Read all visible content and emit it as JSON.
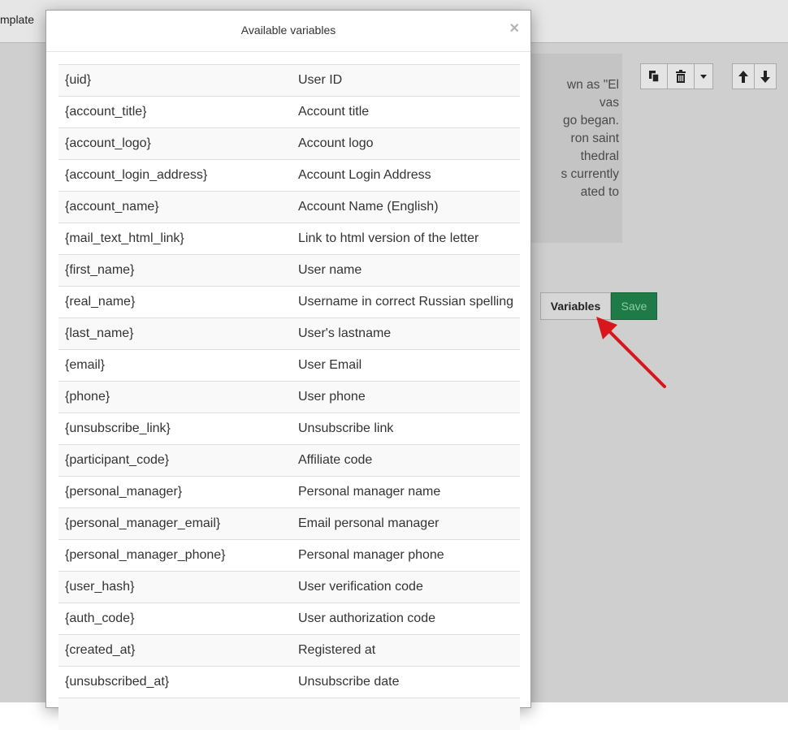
{
  "background": {
    "template_tab": "mplate",
    "preview_text": "wn as \"El\nvas\ngo began.\nron saint\nthedral\ns currently\nated to",
    "variables_button": "Variables",
    "save_button": "Save",
    "colors": {
      "save": "#1e7a46",
      "annotation_arrow": "#d8161c"
    }
  },
  "modal": {
    "title": "Available variables",
    "close": "×",
    "rows": [
      {
        "var": "{uid}",
        "desc": "User ID"
      },
      {
        "var": "{account_title}",
        "desc": "Account title"
      },
      {
        "var": "{account_logo}",
        "desc": "Account logo"
      },
      {
        "var": "{account_login_address}",
        "desc": "Account Login Address"
      },
      {
        "var": "{account_name}",
        "desc": "Account Name (English)"
      },
      {
        "var": "{mail_text_html_link}",
        "desc": "Link to html version of the letter"
      },
      {
        "var": "{first_name}",
        "desc": "User name"
      },
      {
        "var": "{real_name}",
        "desc": "Username in correct Russian spelling"
      },
      {
        "var": "{last_name}",
        "desc": "User's lastname"
      },
      {
        "var": "{email}",
        "desc": "User Email"
      },
      {
        "var": "{phone}",
        "desc": "User phone"
      },
      {
        "var": "{unsubscribe_link}",
        "desc": "Unsubscribe link"
      },
      {
        "var": "{participant_code}",
        "desc": "Affiliate code"
      },
      {
        "var": "{personal_manager}",
        "desc": "Personal manager name"
      },
      {
        "var": "{personal_manager_email}",
        "desc": "Email personal manager"
      },
      {
        "var": "{personal_manager_phone}",
        "desc": "Personal manager phone"
      },
      {
        "var": "{user_hash}",
        "desc": "User verification code"
      },
      {
        "var": "{auth_code}",
        "desc": "User authorization code"
      },
      {
        "var": "{created_at}",
        "desc": "Registered at"
      },
      {
        "var": "{unsubscribed_at}",
        "desc": "Unsubscribe date"
      },
      {
        "var": "",
        "desc": ""
      }
    ]
  }
}
